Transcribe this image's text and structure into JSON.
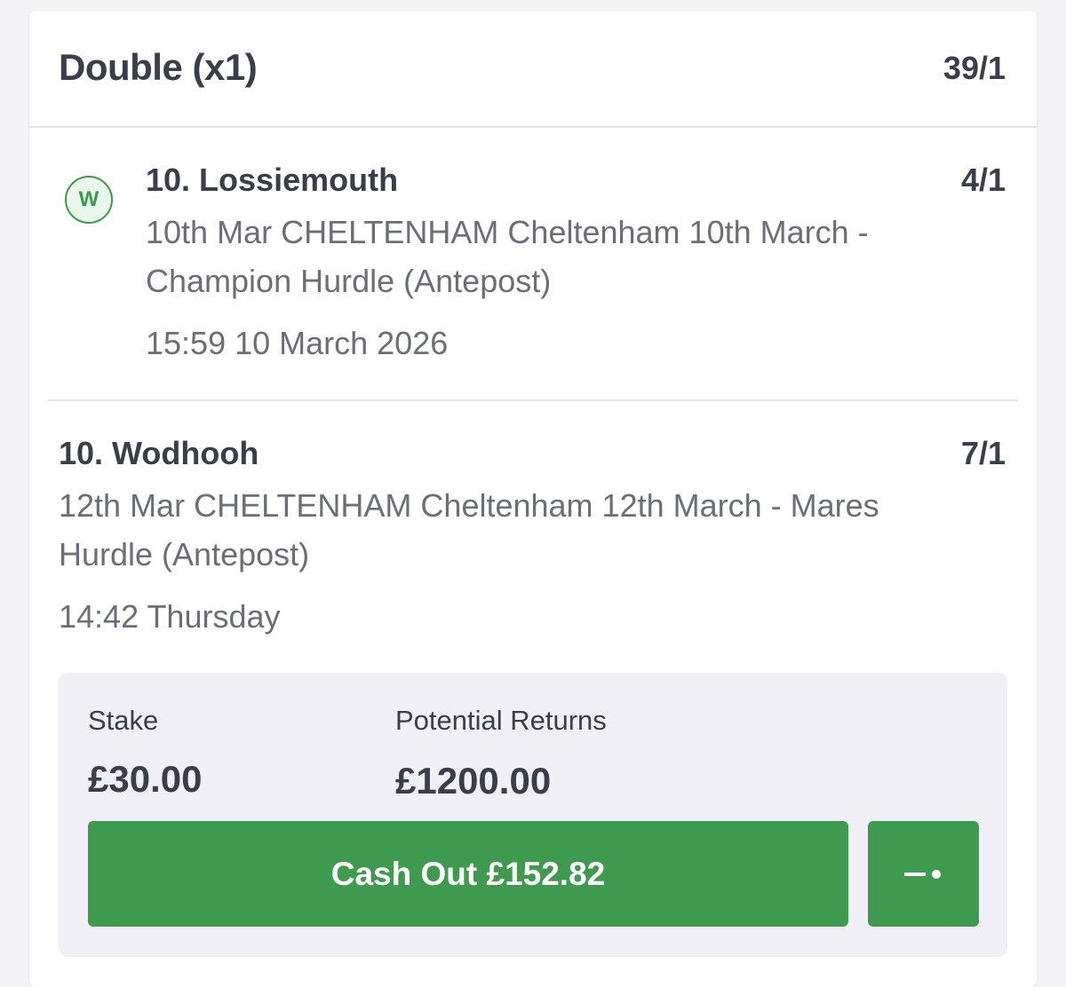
{
  "bet": {
    "type": "Double (x1)",
    "odds": "39/1"
  },
  "selections": [
    {
      "status": "W",
      "runner": "10. Lossiemouth",
      "odds": "4/1",
      "event": "10th Mar CHELTENHAM Cheltenham 10th March - Champion Hurdle (Antepost)",
      "time": "15:59 10 March 2026"
    },
    {
      "runner": "10. Wodhooh",
      "odds": "7/1",
      "event": "12th Mar CHELTENHAM Cheltenham 12th March - Mares Hurdle (Antepost)",
      "time": "14:42 Thursday"
    }
  ],
  "summary": {
    "stake_label": "Stake",
    "stake_value": "£30.00",
    "returns_label": "Potential Returns",
    "returns_value": "£1200.00"
  },
  "actions": {
    "cashout_label": "Cash Out £152.82",
    "partial_cashout_icon": "slider-icon"
  },
  "colors": {
    "accent_green": "#3d9a4e",
    "win_badge_bg": "#eaf6ec",
    "panel_bg": "#efeff5",
    "text_dark": "#3a3d4a",
    "text_muted": "#6b6e78"
  }
}
